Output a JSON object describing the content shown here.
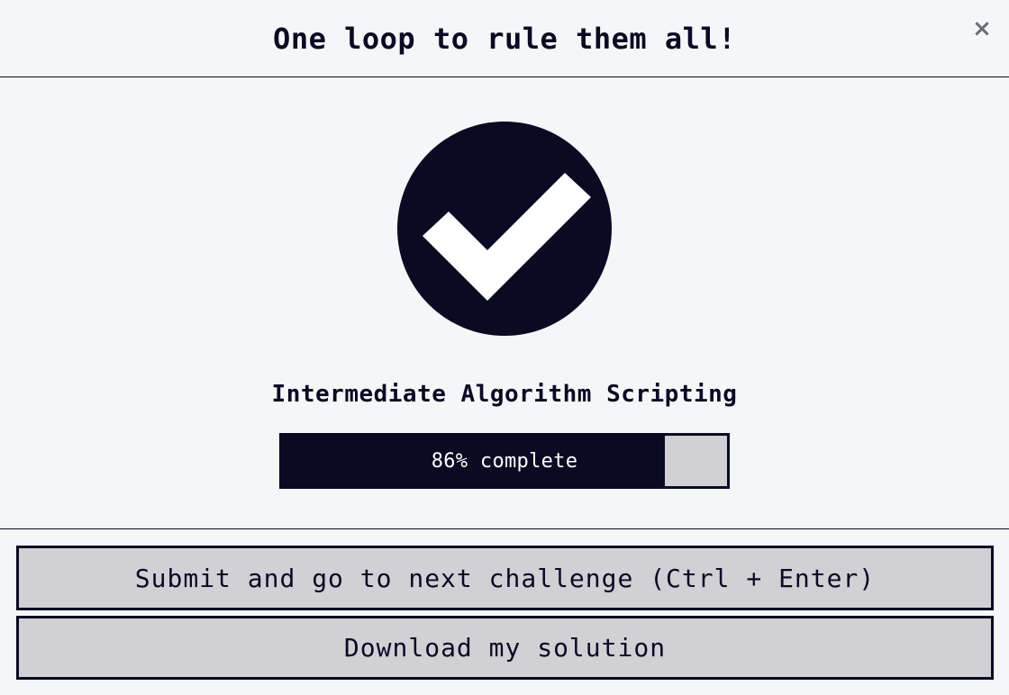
{
  "modal": {
    "title": "One loop to rule them all!",
    "close_label": "×"
  },
  "completion": {
    "icon": "check-circle-icon",
    "certification_title": "Intermediate Algorithm Scripting",
    "progress_percent": 86,
    "progress_label": "86% complete"
  },
  "actions": {
    "submit_label": "Submit and go to next challenge (Ctrl + Enter)",
    "download_label": "Download my solution"
  },
  "colors": {
    "primary": "#0a0a23",
    "background": "#f5f6f7",
    "button_bg": "#d0d0d5",
    "close_icon": "#6c6c7a"
  }
}
